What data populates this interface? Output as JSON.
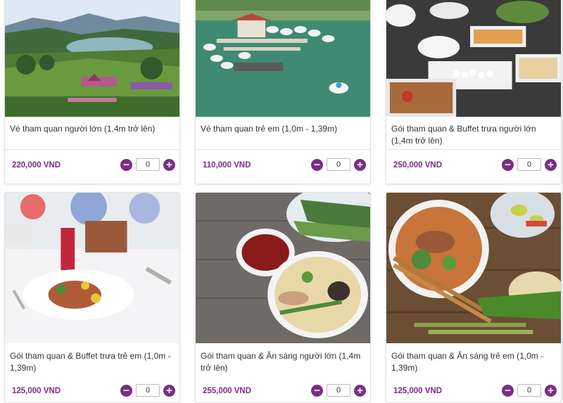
{
  "products": [
    {
      "title": "Vé tham quan người lớn (1,4m trở lên)",
      "price": "220,000 VND",
      "qty": "0",
      "image": "lake-valley-landscape"
    },
    {
      "title": "Vé tham quan trẻ em (1,0m - 1,39m)",
      "price": "110,000 VND",
      "qty": "0",
      "image": "pedal-boat-pier"
    },
    {
      "title": "Gói tham quan & Buffet trưa người lớn (1,4m trở lên)",
      "price": "250,000 VND",
      "qty": "0",
      "image": "buffet-trays"
    },
    {
      "title": "Gói tham quan & Buffet trưa trẻ em (1,0m - 1,39m)",
      "price": "125,000 VND",
      "qty": "0",
      "image": "plated-meal-with-flowers"
    },
    {
      "title": "Gói tham quan & Ăn sáng người lớn (1,4m trở lên)",
      "price": "255,000 VND",
      "qty": "0",
      "image": "noodle-soup-bowl"
    },
    {
      "title": "Gói tham quan & Ăn sáng trẻ em (1,0m - 1,39m)",
      "price": "125,000 VND",
      "qty": "0",
      "image": "pho-with-herbs"
    }
  ],
  "controls": {
    "minus_label": "−",
    "plus_label": "+"
  },
  "colors": {
    "accent": "#7b2d86",
    "price": "#7b2d86"
  }
}
